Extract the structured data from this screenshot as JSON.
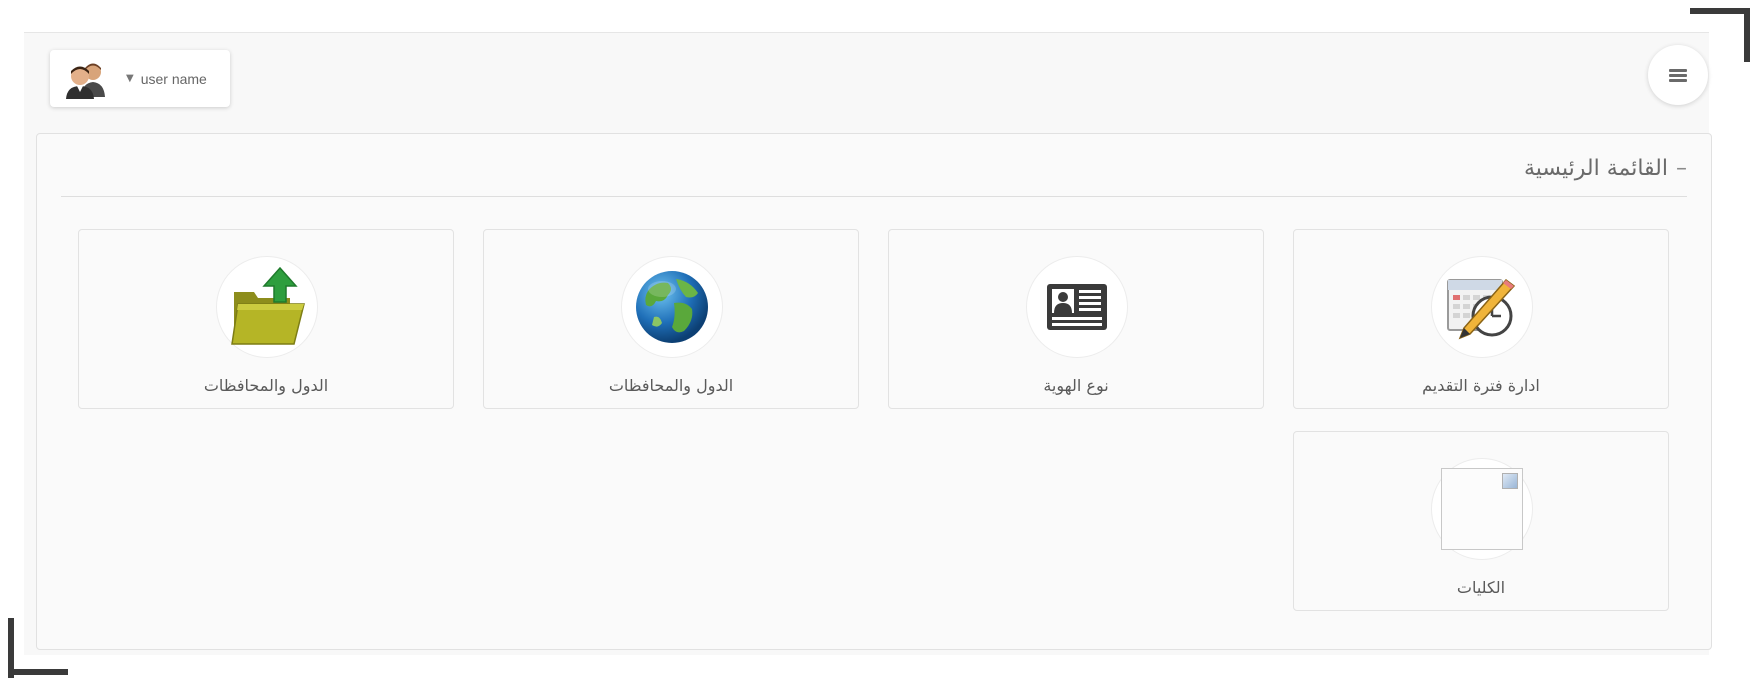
{
  "header": {
    "user_name": "user name",
    "user_menu_caret": "▼",
    "menu_toggle_icon": "hamburger-icon"
  },
  "panel": {
    "title": "القائمة الرئيسية",
    "collapse_symbol": "–"
  },
  "cards": [
    {
      "label": "ادارة فترة التقديم",
      "icon": "calendar-clock-icon"
    },
    {
      "label": "نوع الهوية",
      "icon": "id-card-icon"
    },
    {
      "label": "الدول والمحافظات",
      "icon": "globe-icon"
    },
    {
      "label": "الدول والمحافظات",
      "icon": "folder-upload-icon"
    },
    {
      "label": "الكليات",
      "icon": "broken-image-icon"
    }
  ],
  "colors": {
    "frame_background": "#f8f8f8",
    "panel_background": "#fafafa",
    "text": "#5a5a5a",
    "folder": "#b5b526",
    "upload_arrow": "#2e9e3e",
    "id_card": "#3a3a3a"
  }
}
